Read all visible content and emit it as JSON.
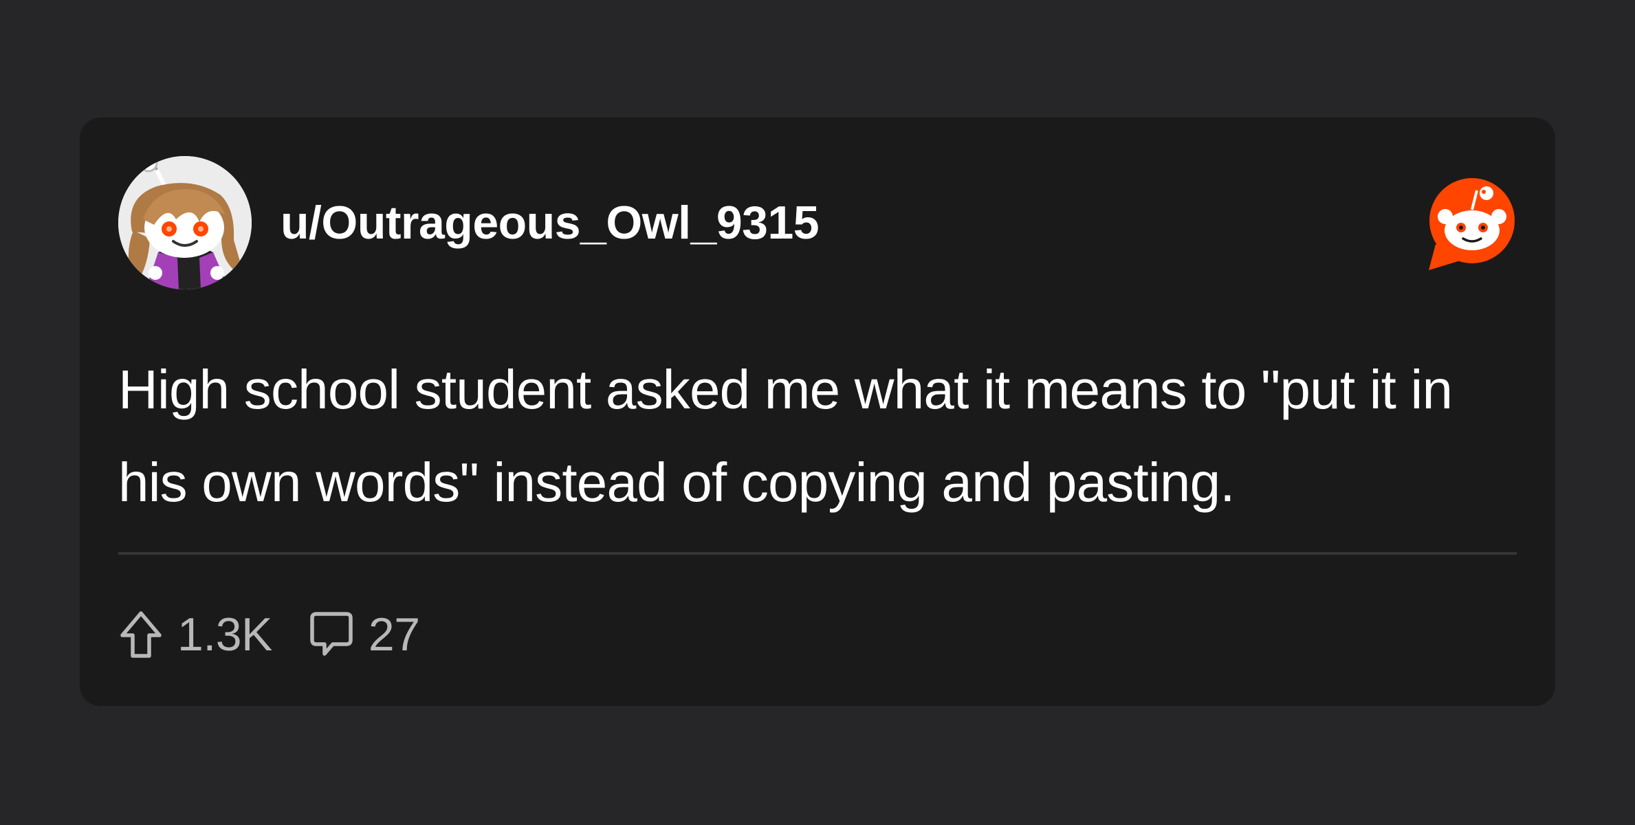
{
  "post": {
    "username": "u/Outrageous_Owl_9315",
    "title": "High school student asked me what it means to \"put it in his own words\" instead of copying and pasting.",
    "upvotes": "1.3K",
    "comments": "27"
  },
  "icons": {
    "avatar": "user-avatar-snoo",
    "brand": "reddit-logo-icon",
    "upvote": "upvote-arrow-icon",
    "comment": "comment-bubble-icon"
  },
  "colors": {
    "page_background": "#262628",
    "card_background": "#1a1a1b",
    "brand_orange": "#ff4500",
    "text_primary": "#ffffff",
    "text_secondary": "#b8b8b8",
    "divider": "#343536"
  }
}
